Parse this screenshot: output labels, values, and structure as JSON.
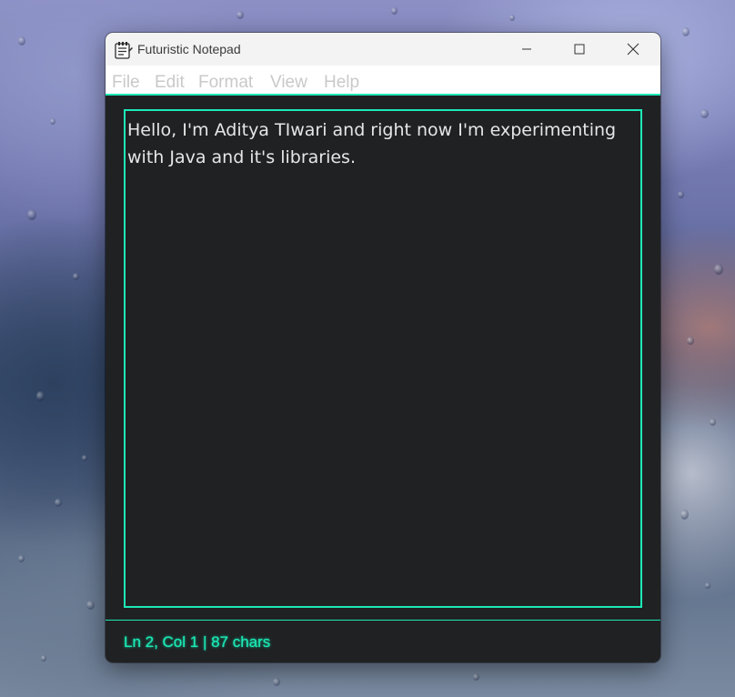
{
  "window": {
    "title": "Futuristic Notepad",
    "icon": "notepad-icon"
  },
  "menu": {
    "items": [
      "File",
      "Edit",
      "Format",
      "View",
      "Help"
    ]
  },
  "editor": {
    "content": "Hello, I'm Aditya TIwari and right now I'm experimenting with Java and it's libraries."
  },
  "status": {
    "text": "Ln 2, Col 1 | 87 chars"
  },
  "colors": {
    "accent": "#1de9b6",
    "editor_bg": "#202123",
    "text": "#e6e6e6"
  }
}
